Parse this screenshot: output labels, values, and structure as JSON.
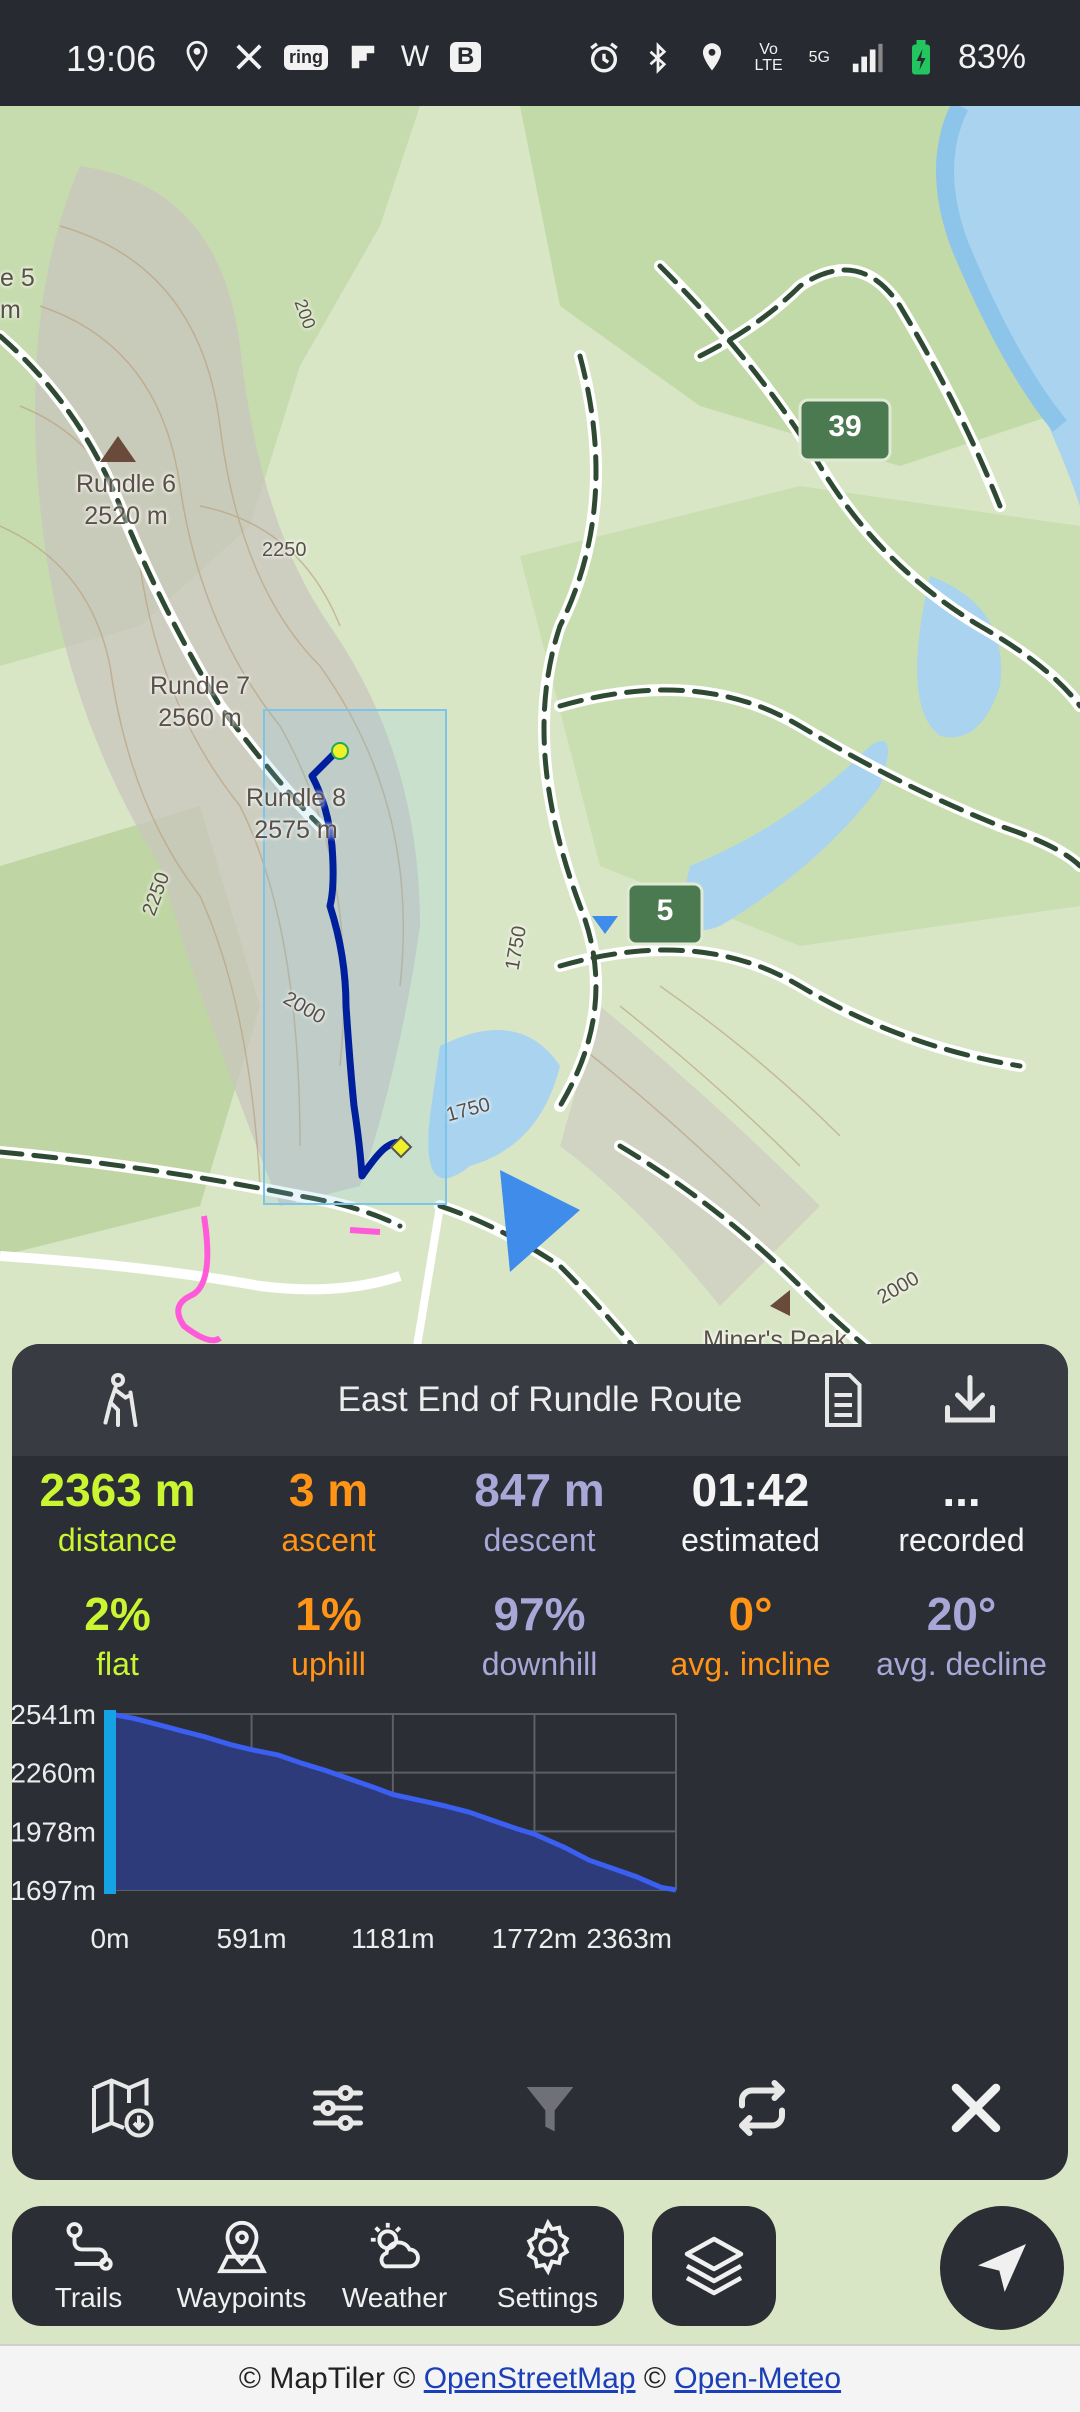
{
  "status_bar": {
    "time": "19:06",
    "left_icons": [
      "location-pin-icon",
      "x-icon",
      "ring-icon",
      "flipboard-icon",
      "w-icon",
      "b-icon"
    ],
    "ring_label": "ring",
    "w_label": "W",
    "b_label": "B",
    "right_icons": [
      "alarm-icon",
      "bluetooth-icon",
      "location-icon",
      "volte-icon",
      "signal-icon",
      "battery-icon"
    ],
    "volte_label": "Vo LTE",
    "network": "5G",
    "battery": "83%"
  },
  "map": {
    "labels": [
      {
        "name": "Rundle 6",
        "sub": "2520 m"
      },
      {
        "name": "Rundle 7",
        "sub": "2560 m"
      },
      {
        "name": "Rundle 8",
        "sub": "2575 m"
      },
      {
        "name": "Miner's Peak",
        "sub": ""
      }
    ],
    "partial_label": "e 5",
    "partial_label_2": "m",
    "contours": [
      "200",
      "2250",
      "2250",
      "2000",
      "1750",
      "1750",
      "2000"
    ],
    "markers": [
      "39",
      "5"
    ],
    "colors": {
      "track": "#001f9c",
      "route_pink": "#ff5ad9",
      "pointer": "#3f8ceb",
      "marker_bg": "#4c7a50"
    }
  },
  "panel": {
    "title": "East End of Rundle Route",
    "stats_top": [
      {
        "value": "2363 m",
        "label": "distance",
        "color": "#c9f531"
      },
      {
        "value": "3 m",
        "label": "ascent",
        "color": "#ff9416"
      },
      {
        "value": "847 m",
        "label": "descent",
        "color": "#a9a7d8"
      },
      {
        "value": "01:42",
        "label": "estimated",
        "color": "#f4f4f4"
      },
      {
        "value": "...",
        "label": "recorded",
        "color": "#f4f4f4"
      }
    ],
    "stats_bottom": [
      {
        "value": "2%",
        "label": "flat",
        "color": "#c9f531"
      },
      {
        "value": "1%",
        "label": "uphill",
        "color": "#ff9416"
      },
      {
        "value": "97%",
        "label": "downhill",
        "color": "#a9a7d8"
      },
      {
        "value": "0°",
        "label": "avg. incline",
        "color": "#ff9416"
      },
      {
        "value": "20°",
        "label": "avg. decline",
        "color": "#a9a7d8"
      }
    ]
  },
  "chart_data": {
    "type": "area",
    "title": "",
    "xlabel": "",
    "ylabel": "",
    "y_ticks": [
      "2541m",
      "2260m",
      "1978m",
      "1697m"
    ],
    "x_ticks": [
      "0m",
      "591m",
      "1181m",
      "1772m",
      "2363m"
    ],
    "xlim": [
      0,
      2363
    ],
    "ylim": [
      1697,
      2541
    ],
    "grid": true,
    "series": [
      {
        "x": [
          0,
          100,
          200,
          300,
          400,
          500,
          591,
          700,
          800,
          900,
          1000,
          1100,
          1181,
          1300,
          1400,
          1500,
          1600,
          1700,
          1772,
          1900,
          2000,
          2100,
          2200,
          2300,
          2363
        ],
        "y": [
          2541,
          2520,
          2490,
          2460,
          2430,
          2395,
          2370,
          2345,
          2305,
          2270,
          2230,
          2190,
          2155,
          2125,
          2100,
          2070,
          2030,
          1990,
          1965,
          1900,
          1840,
          1800,
          1760,
          1710,
          1697
        ]
      }
    ],
    "colors": {
      "fill": "#2e3b7a",
      "line": "#3b5ff0",
      "marker": "#16a3e6"
    }
  },
  "nav": {
    "items": [
      {
        "label": "Trails",
        "icon": "route-icon"
      },
      {
        "label": "Waypoints",
        "icon": "map-pin-icon"
      },
      {
        "label": "Weather",
        "icon": "weather-icon"
      },
      {
        "label": "Settings",
        "icon": "gear-icon"
      }
    ]
  },
  "attribution": {
    "parts": [
      "© MapTiler © ",
      "OpenStreetMap",
      " © ",
      "Open-Meteo"
    ]
  }
}
